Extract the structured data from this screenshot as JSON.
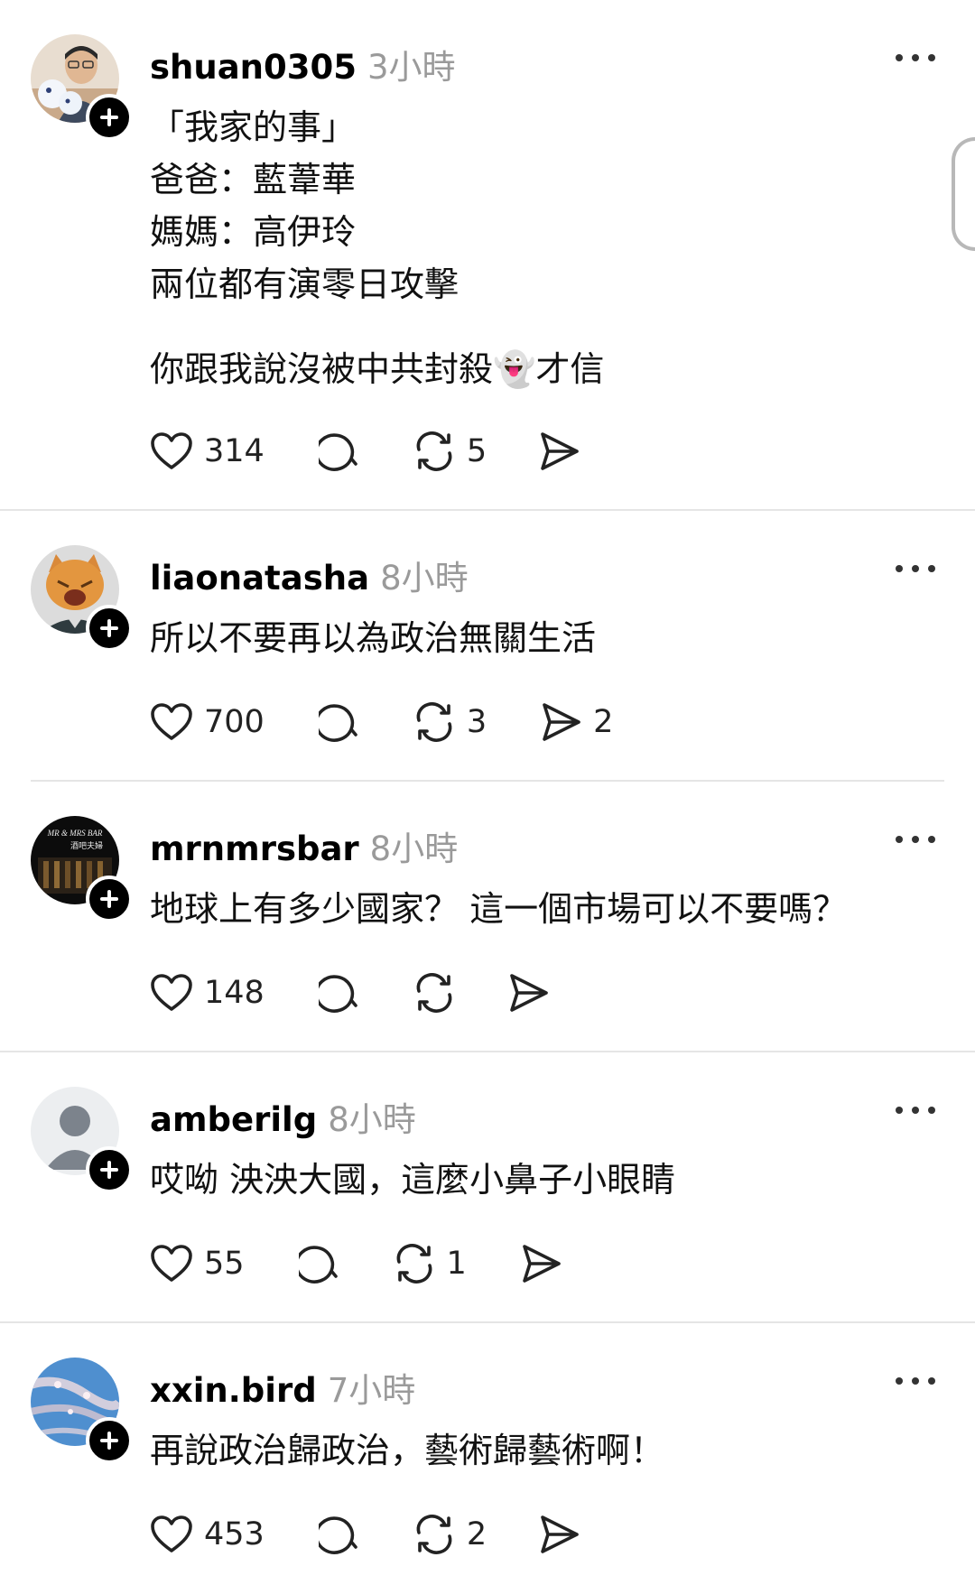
{
  "posts": [
    {
      "username": "shuan0305",
      "time": "3小時",
      "lines": [
        "「我家的事」",
        "爸爸：藍葦華",
        "媽媽：高伊玲",
        "兩位都有演零日攻擊",
        "",
        "你跟我說沒被中共封殺👻才信"
      ],
      "likes": "314",
      "replies": "",
      "reposts": "5",
      "shares": "",
      "avatar": "person-with-plushies"
    },
    {
      "username": "liaonatasha",
      "time": "8小時",
      "lines": [
        "所以不要再以為政治無關生活"
      ],
      "likes": "700",
      "replies": "",
      "reposts": "3",
      "shares": "2",
      "avatar": "orange-cat"
    },
    {
      "username": "mrnmrsbar",
      "time": "8小時",
      "lines": [
        "地球上有多少國家？ 這一個市場可以不要嗎？"
      ],
      "likes": "148",
      "replies": "",
      "reposts": "",
      "shares": "",
      "avatar": "bar-logo",
      "avatar_text": [
        "MR & MRS BAR",
        "酒吧夫婦"
      ]
    },
    {
      "username": "amberilg",
      "time": "8小時",
      "lines": [
        "哎呦 泱泱大國，這麼小鼻子小眼睛"
      ],
      "likes": "55",
      "replies": "",
      "reposts": "1",
      "shares": "",
      "avatar": "default-user"
    },
    {
      "username": "xxin.bird",
      "time": "7小時",
      "lines": [
        "再說政治歸政治，藝術歸藝術啊！"
      ],
      "likes": "453",
      "replies": "",
      "reposts": "2",
      "shares": "",
      "avatar": "blossom-sky"
    }
  ],
  "colors": {
    "text": "#000000",
    "meta": "#9a9a9a",
    "divider": "#e5e5e5",
    "badge": "#000000"
  },
  "icons": [
    "heart-icon",
    "comment-icon",
    "repost-icon",
    "share-icon",
    "more-icon",
    "plus-icon"
  ]
}
